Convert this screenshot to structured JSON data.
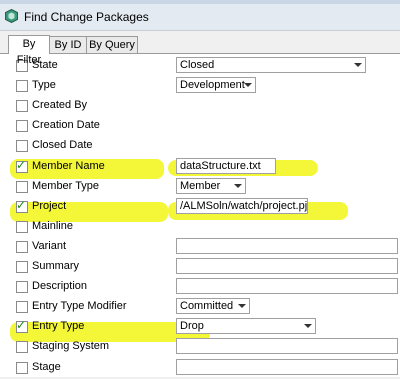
{
  "window": {
    "title": "Find Change Packages",
    "icon": "app-hexagon-icon"
  },
  "tabs": [
    {
      "label": "By Filter",
      "active": true
    },
    {
      "label": "By ID",
      "active": false
    },
    {
      "label": "By Query",
      "active": false
    }
  ],
  "rows": [
    {
      "label": "State",
      "checked": false,
      "value": "Closed",
      "kind": "combo"
    },
    {
      "label": "Type",
      "checked": false,
      "value": "Development",
      "kind": "combo"
    },
    {
      "label": "Created By",
      "checked": false,
      "value": "",
      "kind": "none"
    },
    {
      "label": "Creation Date",
      "checked": false,
      "value": "",
      "kind": "none"
    },
    {
      "label": "Closed Date",
      "checked": false,
      "value": "",
      "kind": "none"
    },
    {
      "label": "Member Name",
      "checked": true,
      "value": "dataStructure.txt",
      "kind": "text"
    },
    {
      "label": "Member Type",
      "checked": false,
      "value": "Member",
      "kind": "combo"
    },
    {
      "label": "Project",
      "checked": true,
      "value": "/ALMSoln/watch/project.pj",
      "kind": "text"
    },
    {
      "label": "Mainline",
      "checked": false,
      "value": "",
      "kind": "none"
    },
    {
      "label": "Variant",
      "checked": false,
      "value": "",
      "kind": "text"
    },
    {
      "label": "Summary",
      "checked": false,
      "value": "",
      "kind": "text"
    },
    {
      "label": "Description",
      "checked": false,
      "value": "",
      "kind": "text"
    },
    {
      "label": "Entry Type Modifier",
      "checked": false,
      "value": "Committed",
      "kind": "combo"
    },
    {
      "label": "Entry Type",
      "checked": true,
      "value": "Drop",
      "kind": "combo"
    },
    {
      "label": "Staging System",
      "checked": false,
      "value": "",
      "kind": "text"
    },
    {
      "label": "Stage",
      "checked": false,
      "value": "",
      "kind": "text"
    }
  ],
  "colors": {
    "highlight": "#f0f500",
    "checkmark": "#1a8a1a"
  }
}
